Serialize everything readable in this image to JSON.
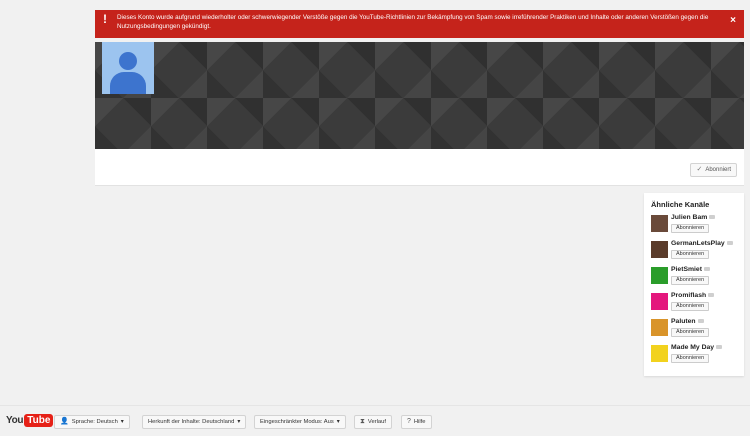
{
  "alert": {
    "icon": "exclamation-icon",
    "message": "Dieses Konto wurde aufgrund wiederholter oder schwerwiegender Verstöße gegen die YouTube-Richtlinien zur Bekämpfung von Spam sowie irreführender Praktiken und Inhalte oder anderen Verstößen gegen die Nutzungsbedingungen gekündigt.",
    "close": "×"
  },
  "channel": {
    "subscribed_label": "Abonniert"
  },
  "related": {
    "title": "Ähnliche Kanäle",
    "items": [
      {
        "name": "Julien Bam",
        "button": "Abonnieren",
        "color": "#6a4a3a"
      },
      {
        "name": "GermanLetsPlay",
        "button": "Abonnieren",
        "color": "#5a3b2a"
      },
      {
        "name": "PietSmiet",
        "button": "Abonnieren",
        "color": "#2a9d2a"
      },
      {
        "name": "Promiflash",
        "button": "Abonnieren",
        "color": "#e4177d"
      },
      {
        "name": "Paluten",
        "button": "Abonnieren",
        "color": "#d9942a"
      },
      {
        "name": "Made My Day",
        "button": "Abonnieren",
        "color": "#f2d21e"
      }
    ]
  },
  "footer": {
    "logo_you": "You",
    "logo_tube": "Tube",
    "language": "Sprache: Deutsch",
    "location": "Herkunft der Inhalte: Deutschland",
    "restricted": "Eingeschränkter Modus: Aus",
    "history": "Verlauf",
    "help": "Hilfe"
  }
}
